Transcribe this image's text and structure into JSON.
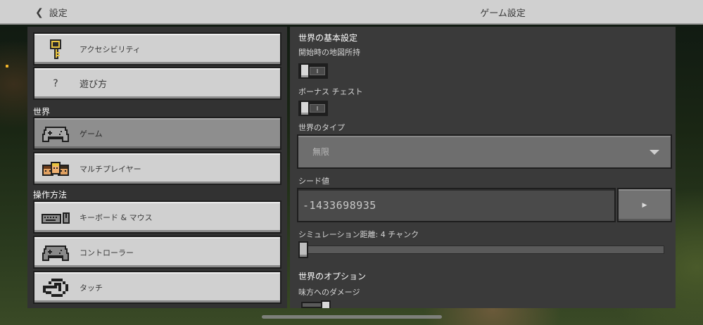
{
  "topbar": {
    "back_label": "設定",
    "title": "ゲーム設定"
  },
  "sidebar": {
    "items_top": [
      {
        "label": "アクセシビリティ",
        "icon": "key-icon"
      },
      {
        "label": "遊び方",
        "icon": "question-mark-icon",
        "glyph": "?"
      }
    ],
    "sections": [
      {
        "label": "世界",
        "items": [
          {
            "label": "ゲーム",
            "icon": "controller-icon",
            "selected": true
          },
          {
            "label": "マルチプレイヤー",
            "icon": "players-icon"
          }
        ]
      },
      {
        "label": "操作方法",
        "items": [
          {
            "label": "キーボード & マウス",
            "icon": "keyboard-mouse-icon"
          },
          {
            "label": "コントローラー",
            "icon": "gamepad-icon"
          },
          {
            "label": "タッチ",
            "icon": "touch-hand-icon"
          }
        ]
      }
    ]
  },
  "main": {
    "heading_basic": "世界の基本設定",
    "starting_map_label": "開始時の地図所持",
    "starting_map_on": false,
    "bonus_chest_label": "ボーナス チェスト",
    "bonus_chest_on": false,
    "world_type_label": "世界のタイプ",
    "world_type_value": "無限",
    "seed_label": "シード値",
    "seed_value": "-1433698935",
    "seed_button_glyph": "▶",
    "sim_distance_label": "シミュレーション距離: 4 チャンク",
    "sim_distance_fraction": 0.0,
    "heading_options": "世界のオプション",
    "friendly_fire_label": "味方へのダメージ",
    "friendly_fire_on": true
  },
  "colors": {
    "button_face": "#d0d0d0",
    "button_selected": "#8e8e8e",
    "panel_dark": "#323232",
    "panel_right": "#3a3a3a"
  }
}
